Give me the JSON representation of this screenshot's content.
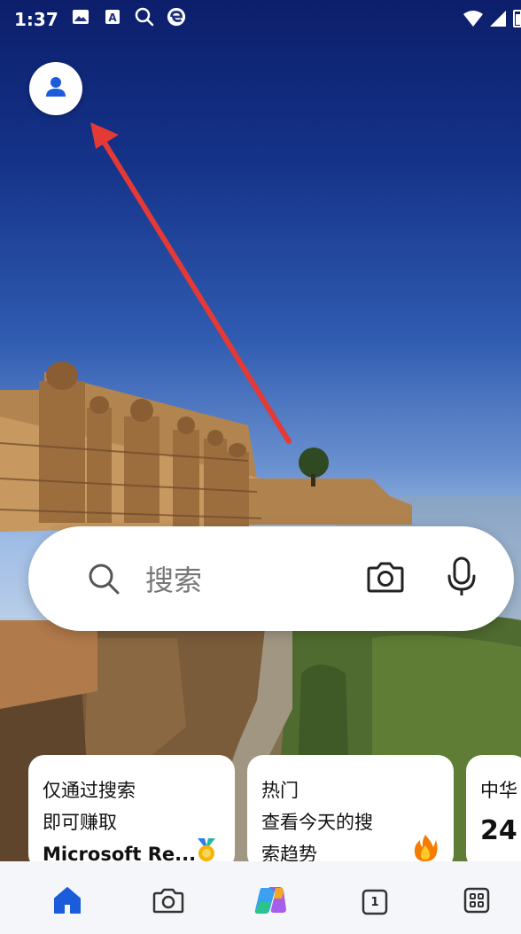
{
  "status_bar": {
    "time": "1:37",
    "icons": [
      "image-icon",
      "a-icon",
      "search-icon",
      "edge-icon"
    ],
    "right_icons": [
      "wifi-icon",
      "signal-icon",
      "battery-icon"
    ]
  },
  "profile": {
    "icon": "person-icon"
  },
  "search": {
    "placeholder": "搜索",
    "camera_icon": "camera-icon",
    "mic_icon": "mic-icon"
  },
  "cards": [
    {
      "lines": [
        "仅通过搜索",
        "即可赚取",
        "Microsoft Re..."
      ],
      "icon": "medal-icon"
    },
    {
      "lines": [
        "热门",
        "查看今天的搜",
        "索趋势"
      ],
      "icon": "fire-icon"
    },
    {
      "lines": [
        "中华"
      ],
      "big": "24"
    }
  ],
  "bottom_nav": {
    "items": [
      {
        "name": "home",
        "icon": "home-icon"
      },
      {
        "name": "camera",
        "icon": "camera-icon"
      },
      {
        "name": "copilot",
        "icon": "copilot-icon"
      },
      {
        "name": "tabs",
        "icon": "tabs-icon",
        "count": "1"
      },
      {
        "name": "apps",
        "icon": "apps-icon"
      }
    ]
  },
  "colors": {
    "accent": "#1a5cd9",
    "arrow": "#e53935",
    "nav_bg": "#f4f6f9"
  }
}
